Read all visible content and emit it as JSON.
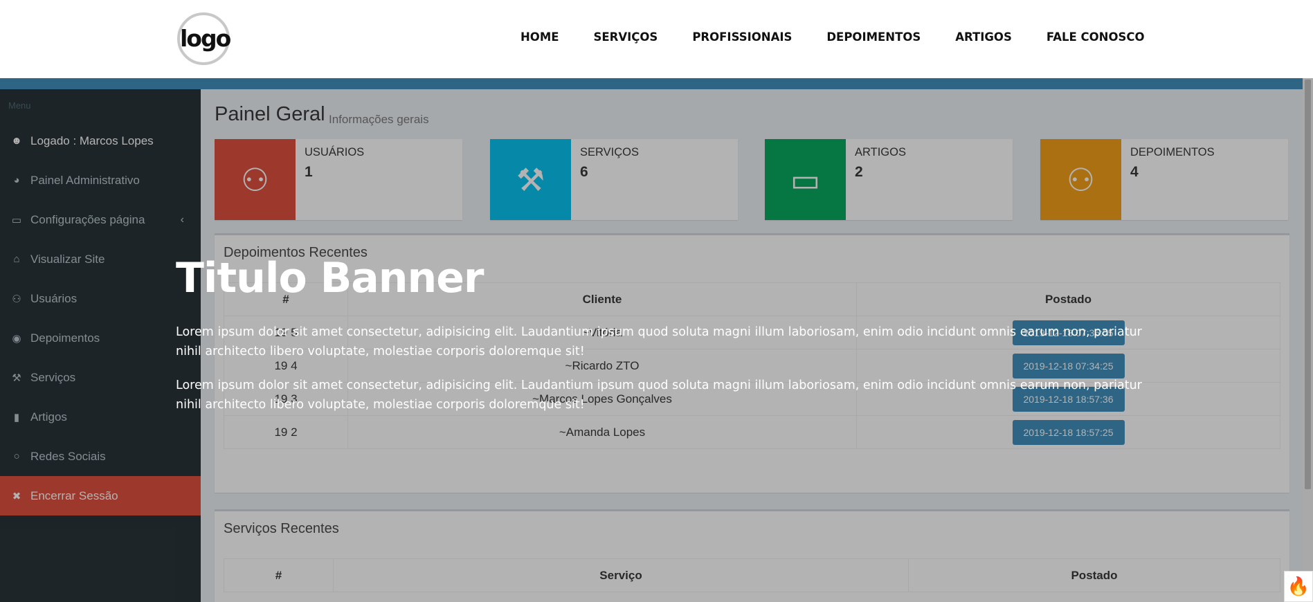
{
  "header": {
    "logo_text": "logo",
    "nav": [
      "HOME",
      "SERVIÇOS",
      "PROFISSIONAIS",
      "DEPOIMENTOS",
      "ARTIGOS",
      "FALE CONOSCO"
    ]
  },
  "sidebar": {
    "menu_label": "Menu",
    "items": [
      {
        "label": "Logado : Marcos Lopes",
        "icon": "user-icon"
      },
      {
        "label": "Painel Administrativo",
        "icon": "dashboard-icon"
      },
      {
        "label": "Configurações página",
        "icon": "monitor-icon"
      },
      {
        "label": "Visualizar Site",
        "icon": "home-icon"
      },
      {
        "label": "Usuários",
        "icon": "users-icon"
      },
      {
        "label": "Depoimentos",
        "icon": "eye-icon"
      },
      {
        "label": "Serviços",
        "icon": "wrench-icon"
      },
      {
        "label": "Artigos",
        "icon": "book-icon"
      },
      {
        "label": "Redes Sociais",
        "icon": "comments-icon"
      },
      {
        "label": "Encerrar Sessão",
        "icon": "close-icon"
      }
    ]
  },
  "main": {
    "title": "Painel Geral",
    "subtitle": "Informações gerais",
    "info_boxes": [
      {
        "label": "USUÁRIOS",
        "value": "1",
        "color": "#dd4b39",
        "icon": "users-icon"
      },
      {
        "label": "SERVIÇOS",
        "value": "6",
        "color": "#00c0ef",
        "icon": "wrench-icon"
      },
      {
        "label": "ARTIGOS",
        "value": "2",
        "color": "#00a65a",
        "icon": "folder-icon"
      },
      {
        "label": "DEPOIMENTOS",
        "value": "4",
        "color": "#f39c12",
        "icon": "users-icon"
      }
    ],
    "depoimentos": {
      "title": "Depoimentos Recentes",
      "columns": [
        "#",
        "Cliente",
        "Postado"
      ],
      "rows": [
        {
          "id": "19 5",
          "cliente": "~Vitória",
          "postado": "2019-12-18 07:35:05"
        },
        {
          "id": "19 4",
          "cliente": "~Ricardo ZTO",
          "postado": "2019-12-18 07:34:25"
        },
        {
          "id": "19 3",
          "cliente": "~Marcos Lopes Gonçalves",
          "postado": "2019-12-18 18:57:36"
        },
        {
          "id": "19 2",
          "cliente": "~Amanda Lopes",
          "postado": "2019-12-18 18:57:25"
        }
      ]
    },
    "servicos": {
      "title": "Serviços Recentes",
      "columns": [
        "#",
        "Serviço",
        "Postado"
      ]
    }
  },
  "banner": {
    "title": "Titulo Banner",
    "paragraph1": "Lorem ipsum dolor sit amet consectetur, adipisicing elit. Laudantium ipsum quod soluta magni illum laboriosam, enim odio incidunt omnis earum non, pariatur nihil architecto libero voluptate, molestiae corporis doloremque sit!",
    "paragraph2": "Lorem ipsum dolor sit amet consectetur, adipisicing elit. Laudantium ipsum quod soluta magni illum laboriosam, enim odio incidunt omnis earum non, pariatur nihil architecto libero voluptate, molestiae corporis doloremque sit!"
  }
}
